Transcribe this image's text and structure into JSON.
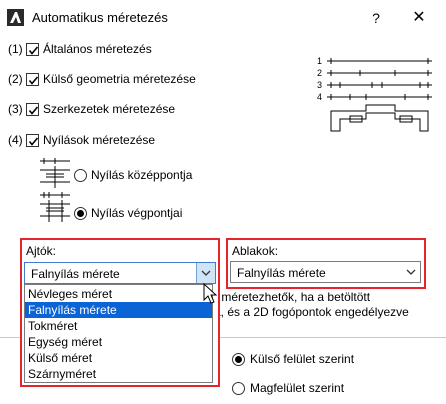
{
  "window": {
    "title": "Automatikus méretezés",
    "help": "?",
    "close": "✕"
  },
  "options": [
    {
      "num": "(1)",
      "label": "Általános méretezés",
      "checked": true
    },
    {
      "num": "(2)",
      "label": "Külső geometria méretezése",
      "checked": true
    },
    {
      "num": "(3)",
      "label": "Szerkezetek méretezése",
      "checked": true
    },
    {
      "num": "(4)",
      "label": "Nyílások méretezése",
      "checked": true
    }
  ],
  "diagram": {
    "levels": [
      "1",
      "2",
      "3",
      "4"
    ]
  },
  "opening_mode": [
    {
      "label": "Nyílás középpontja",
      "selected": false
    },
    {
      "label": "Nyílás végpontjai",
      "selected": true
    }
  ],
  "doors": {
    "label": "Ajtók:",
    "value": "Falnyílás mérete",
    "options": [
      "Névleges méret",
      "Falnyílás mérete",
      "Tokméret",
      "Egység méret",
      "Külső méret",
      "Szárnyméret"
    ],
    "selected_index": 1
  },
  "windows": {
    "label": "Ablakok:",
    "value": "Falnyílás mérete"
  },
  "info_lines": [
    "r méretezhetők, ha a betöltött",
    "a, és a 2D fogópontok engedélyezve"
  ],
  "surface": [
    {
      "label": "Külső felület szerint",
      "selected": true
    },
    {
      "label": "Magfelület szerint",
      "selected": false
    }
  ]
}
